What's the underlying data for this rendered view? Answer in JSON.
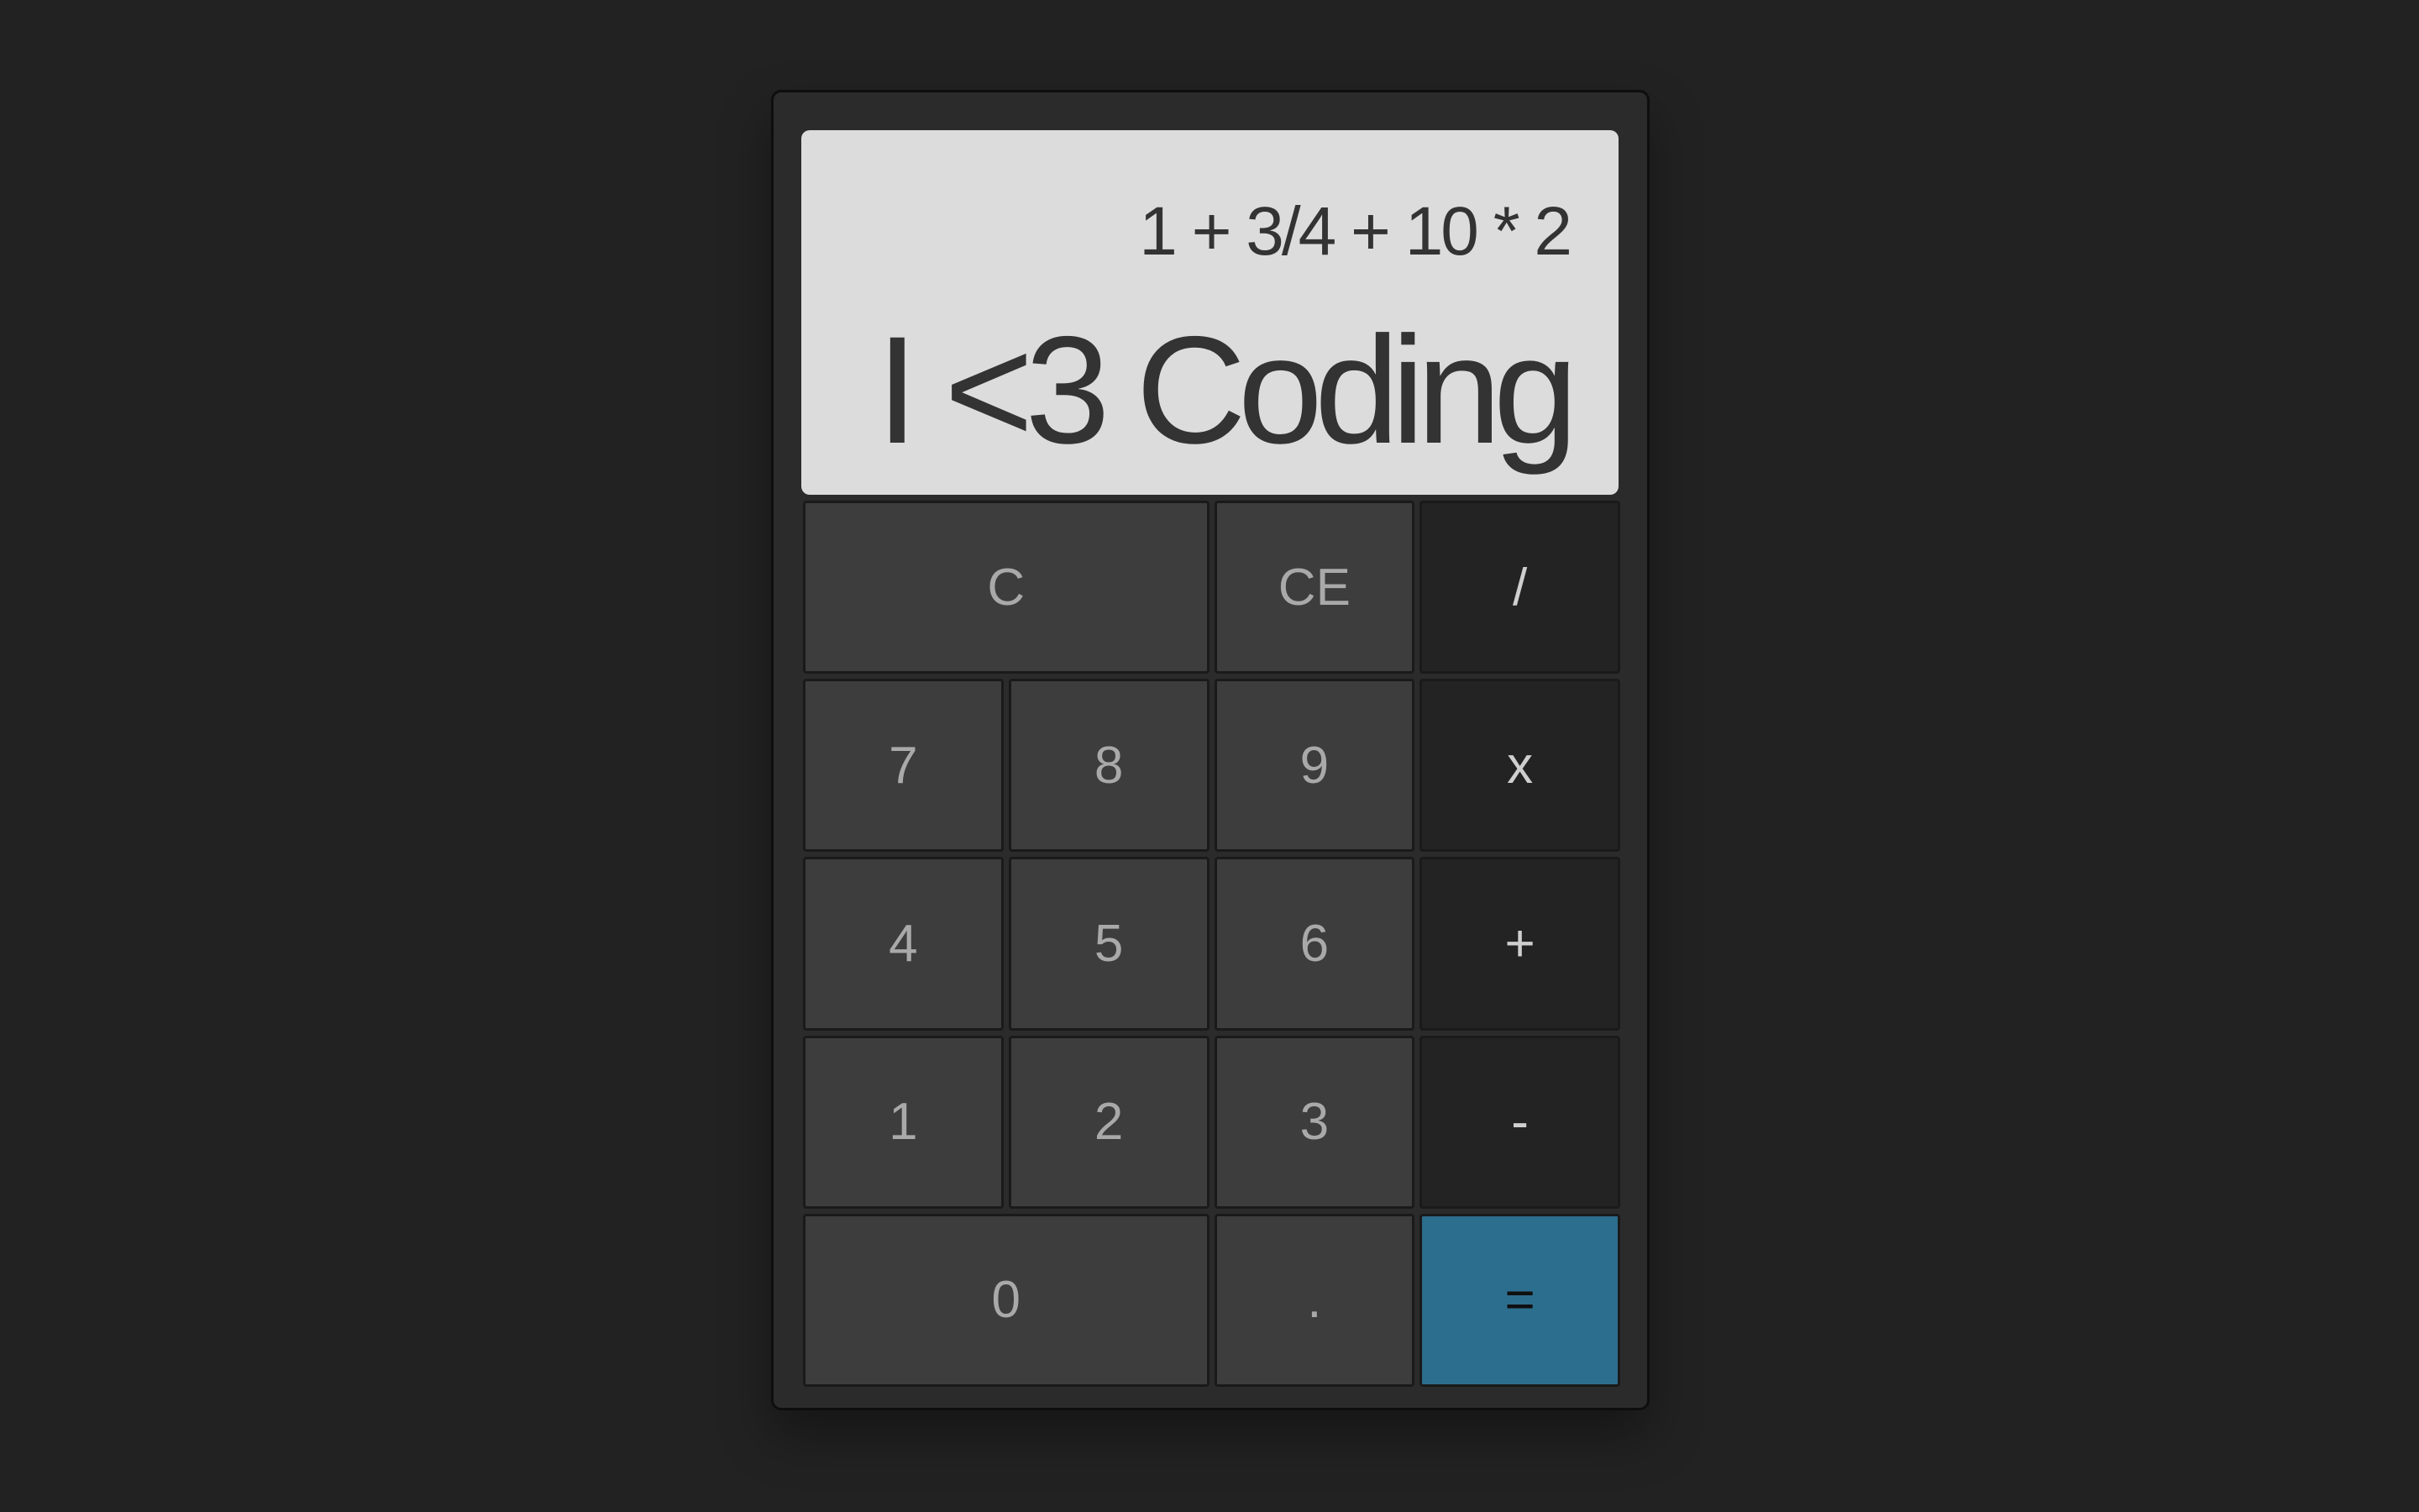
{
  "display": {
    "expression": "1 + 3/4 + 10 * 2",
    "result": "I <3 Coding"
  },
  "keys": {
    "clear": "C",
    "clear_entry": "CE",
    "divide": "/",
    "seven": "7",
    "eight": "8",
    "nine": "9",
    "multiply": "x",
    "four": "4",
    "five": "5",
    "six": "6",
    "add": "+",
    "one": "1",
    "two": "2",
    "three": "3",
    "subtract": "-",
    "zero": "0",
    "decimal": ".",
    "equals": "="
  },
  "colors": {
    "background": "#222222",
    "body": "#2b2b2b",
    "display": "#dcdcdc",
    "key": "#3d3d3d",
    "operator_key": "#232323",
    "equals_key": "#2c6e8d"
  }
}
